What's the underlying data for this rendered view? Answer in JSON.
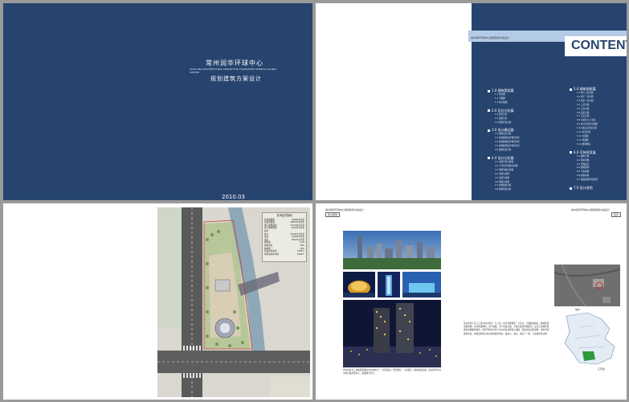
{
  "cover": {
    "title_cn": "常州润华环球中心",
    "title_en": "PLAN AND ARCHITECTURAL DESIGN FOR CHANGZHOU RUNHUA GLOBAL CENTER",
    "subtitle": "规划建筑方案设计",
    "date": "2010.03"
  },
  "contents": {
    "band_text": "常州润华环球中心规划建筑方案设计",
    "title": "CONTENT",
    "left_sections": [
      {
        "label": "1.0 建筑套组篇",
        "items": [
          "1.1 区位图",
          "1.2 鸟瞰图",
          "1.3 总平面图"
        ]
      },
      {
        "label": "2.0 区位分析篇",
        "items": [
          "2.1 区位分析",
          "2.2 现状分析",
          "2.3 周边环境分析"
        ]
      },
      {
        "label": "3.0 设计概念篇",
        "items": [
          "3.1 规划设计分析",
          "3.2 总体建筑设计构思分析",
          "3.3 总体建筑设计构思分析",
          "3.4 总体建筑设计构思分析",
          "3.5 建筑造型分析"
        ]
      },
      {
        "label": "4.0 设计分析篇",
        "items": [
          "4.1 功能分区分析图",
          "4.2 人行车行流线分析图",
          "4.3 消防流线分析图",
          "4.4 景观分析图",
          "4.5 日照分析图",
          "4.6 绿地分析图",
          "4.7 交通组织分析",
          "4.8 建筑形态分析"
        ]
      }
    ],
    "right_sections": [
      {
        "label": "5.0 建筑图纸篇",
        "items": [
          "5.1 地下二层平面",
          "5.2 地下一层平面",
          "5.3 首层一层平面",
          "5.4 二层平面",
          "5.5 三层平面",
          "5.6 四层平面",
          "5.7 五层平面",
          "5.8 六层及以上平面",
          "5.9 办公标准层平面图",
          "5.10 酒店标准层平面",
          "5.11 屋顶平面",
          "5.12 立面图",
          "5.13 剖面图",
          "5.14 建筑构造"
        ]
      },
      {
        "label": "6.0 可持续发展",
        "items": [
          "6.1 建筑节能",
          "6.2 雨水回收",
          "6.3 景观设计",
          "6.4 建筑照明",
          "6.5 节水灌溉",
          "6.6 建筑材料",
          "6.7 规范建筑环境说明"
        ]
      },
      {
        "label": "7.0 设计说明",
        "items": []
      }
    ]
  },
  "site_plan": {
    "legend_title": "技术经济指标",
    "legend_rows": [
      {
        "k": "总用地面积",
        "v": "41869平方米"
      },
      {
        "k": "总建筑面积",
        "v": "268300平方米"
      },
      {
        "k": "地上建筑面积",
        "v": "213100平方米"
      },
      {
        "k": "地下建筑面积",
        "v": "55200平方米"
      },
      {
        "k": "其中",
        "v": ""
      },
      {
        "k": "办公",
        "v": "112870平方米"
      },
      {
        "k": "商业",
        "v": "41960平方米"
      },
      {
        "k": "酒店",
        "v": "58270平方米"
      },
      {
        "k": "容积率",
        "v": "5.09"
      },
      {
        "k": "建筑密度",
        "v": "30%"
      },
      {
        "k": "绿地率",
        "v": "30%"
      },
      {
        "k": "机动车停车位",
        "v": "1560个"
      },
      {
        "k": "非机动车停车位",
        "v": "2300个"
      }
    ]
  },
  "location": {
    "header_left": "常州润华环球中心规划建筑方案设计",
    "header_left_tag": "区位概述",
    "header_right": "常州润华环球中心规划建筑方案设计",
    "header_right_tag": "区位",
    "paragraph_main": "常州市位于长江三角洲中心地带，与上海、南京等距相望，与苏州、无锡联袂成片，构成苏锡常都市圈。常州交通便利，沪宁铁路、沪宁高速公路、京杭大运河穿城而过，是长三角地区重要的交通枢纽城市。润华环球中心位于常州市新北区核心地段，周边商业氛围浓厚，城市景观资源丰富。本项目将成为常州新的城市地标，集办公、商业、酒店于一体，打造城市综合体。",
    "paragraph_caption": "常州市是长三角地区重要的中心城市之一，经济发达、历史悠久、人文荟萃，城市发展迅速，新北区作为常州的行政文化中心，发展潜力巨大。",
    "map_label_1": "常州",
    "map_label_2": "江苏省"
  }
}
